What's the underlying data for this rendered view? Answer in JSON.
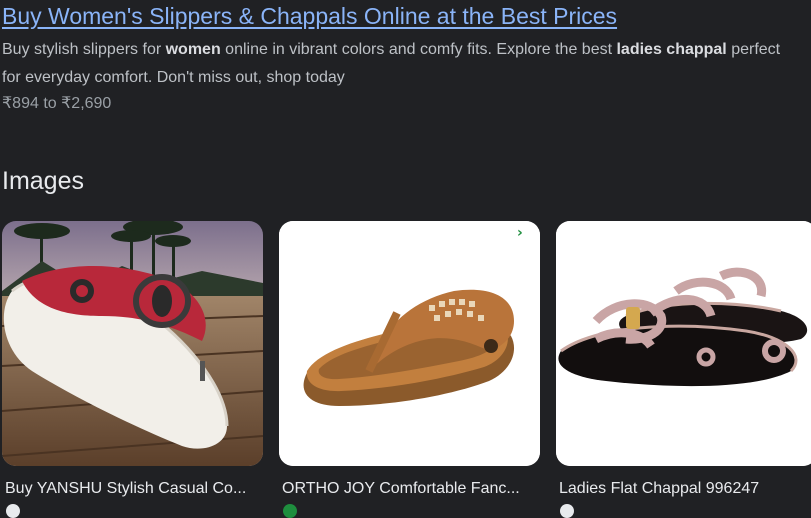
{
  "result": {
    "title": "Buy Women's Slippers & Chappals Online at the Best Prices",
    "snippet_parts": [
      {
        "text": "Buy stylish slippers for ",
        "bold": false
      },
      {
        "text": "women",
        "bold": true
      },
      {
        "text": " online in vibrant colors and comfy fits. Explore the best ",
        "bold": false
      },
      {
        "text": "ladies chappal",
        "bold": true
      },
      {
        "text": " perfect for everyday comfort. Don't miss out, shop today",
        "bold": false
      }
    ],
    "price_range": "₹894 to ₹2,690"
  },
  "images_section": {
    "heading": "Images",
    "items": [
      {
        "caption": "Buy YANSHU Stylish Casual Co...",
        "icon": "red-white-thong-slipper-image"
      },
      {
        "caption": "ORTHO JOY Comfortable Fanc...",
        "icon": "tan-orthopedic-sandal-image"
      },
      {
        "caption": "Ladies Flat Chappal 996247",
        "icon": "rose-gold-flat-chappal-image"
      }
    ]
  },
  "colors": {
    "background": "#202124",
    "link": "#8ab4f8",
    "text": "#bdc1c6",
    "heading": "#e8eaed"
  }
}
